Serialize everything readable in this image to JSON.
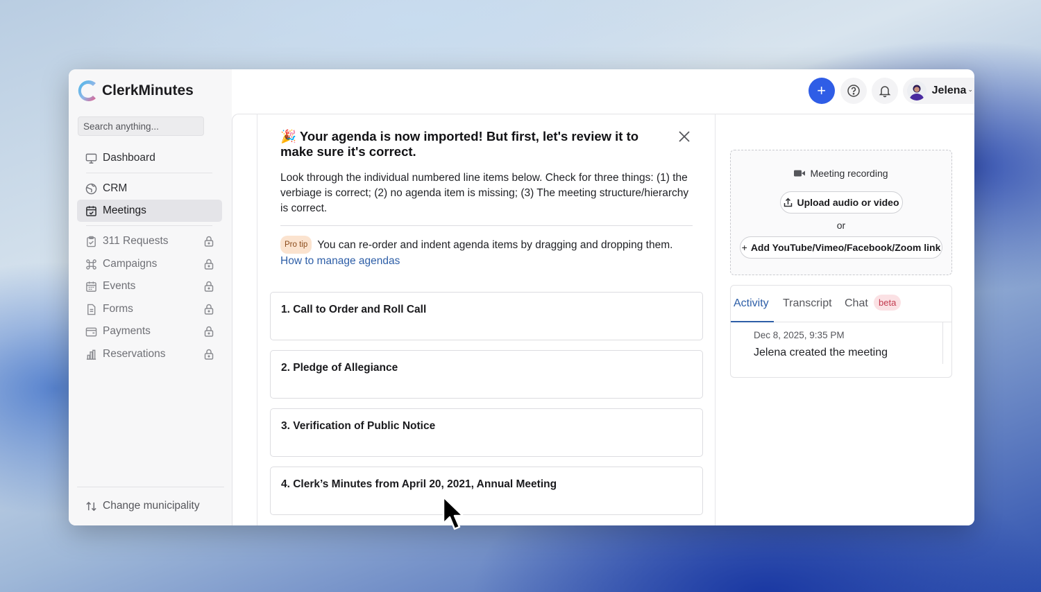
{
  "app": {
    "name": "ClerkMinutes"
  },
  "search": {
    "placeholder": "Search anything..."
  },
  "sidebar": {
    "items": [
      {
        "label": "Dashboard",
        "icon": "monitor-icon",
        "locked": false
      },
      {
        "label": "CRM",
        "icon": "globe-icon",
        "locked": false
      },
      {
        "label": "Meetings",
        "icon": "calendar-check-icon",
        "locked": false,
        "active": true
      },
      {
        "label": "311 Requests",
        "icon": "clipboard-check-icon",
        "locked": true
      },
      {
        "label": "Campaigns",
        "icon": "command-icon",
        "locked": true
      },
      {
        "label": "Events",
        "icon": "calendar-icon",
        "locked": true
      },
      {
        "label": "Forms",
        "icon": "document-icon",
        "locked": true
      },
      {
        "label": "Payments",
        "icon": "wallet-icon",
        "locked": true
      },
      {
        "label": "Reservations",
        "icon": "chart-bars-icon",
        "locked": true
      }
    ],
    "change_municipality": "Change municipality"
  },
  "header": {
    "add_label": "+",
    "username": "Jelena"
  },
  "banner": {
    "emoji": "🎉",
    "title": "Your agenda is now imported! But first, let's review it to make sure it's correct.",
    "body": "Look through the individual numbered line items below. Check for three things: (1) the verbiage is correct; (2) no agenda item is missing; (3) The meeting structure/hierarchy is correct.",
    "protip_badge": "Pro tip",
    "protip_text": "You can re-order and indent agenda items by dragging and dropping them.",
    "protip_link": "How to manage agendas"
  },
  "agenda": {
    "items": [
      "1. Call to Order and Roll Call",
      "2. Pledge of Allegiance",
      "3. Verification of Public Notice",
      "4. Clerk’s Minutes from April 20, 2021, Annual Meeting"
    ]
  },
  "recording": {
    "label": "Meeting recording",
    "upload_label": "Upload audio or video",
    "or_label": "or",
    "link_label": "Add YouTube/Vimeo/Facebook/Zoom link"
  },
  "activity": {
    "tabs": [
      "Activity",
      "Transcript",
      "Chat"
    ],
    "beta_label": "beta",
    "date": "Dec 8, 2025, 9:35 PM",
    "text": "Jelena created the meeting"
  },
  "colors": {
    "accent": "#2f5de6",
    "link": "#2d5ea7",
    "beta": "#c23a4e",
    "protip": "#fbe3cf"
  }
}
